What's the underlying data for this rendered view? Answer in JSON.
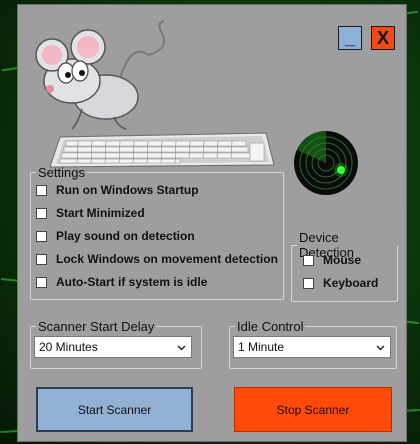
{
  "window_controls": {
    "minimize_label": "_",
    "close_label": "X"
  },
  "settings": {
    "legend": "Settings",
    "options": [
      {
        "label": "Run on Windows Startup",
        "checked": false
      },
      {
        "label": "Start Minimized",
        "checked": false
      },
      {
        "label": "Play sound on detection",
        "checked": false
      },
      {
        "label": "Lock Windows on movement detection",
        "checked": false
      },
      {
        "label": "Auto-Start if system is idle",
        "checked": false
      }
    ]
  },
  "device_detection": {
    "legend": "Device Detection",
    "options": [
      {
        "label": "Mouse",
        "checked": false
      },
      {
        "label": "Keyboard",
        "checked": false
      }
    ]
  },
  "scanner_start_delay": {
    "legend": "Scanner Start Delay",
    "selected": "20 Minutes"
  },
  "idle_control": {
    "legend": "Idle Control",
    "selected": "1 Minute"
  },
  "actions": {
    "start_label": "Start Scanner",
    "stop_label": "Stop Scanner"
  },
  "colors": {
    "start_button": "#93b1d4",
    "stop_button": "#ff4a0a",
    "minimize_button": "#8db0d8",
    "close_button": "#f04a12",
    "radar_blip": "#39ff39"
  }
}
